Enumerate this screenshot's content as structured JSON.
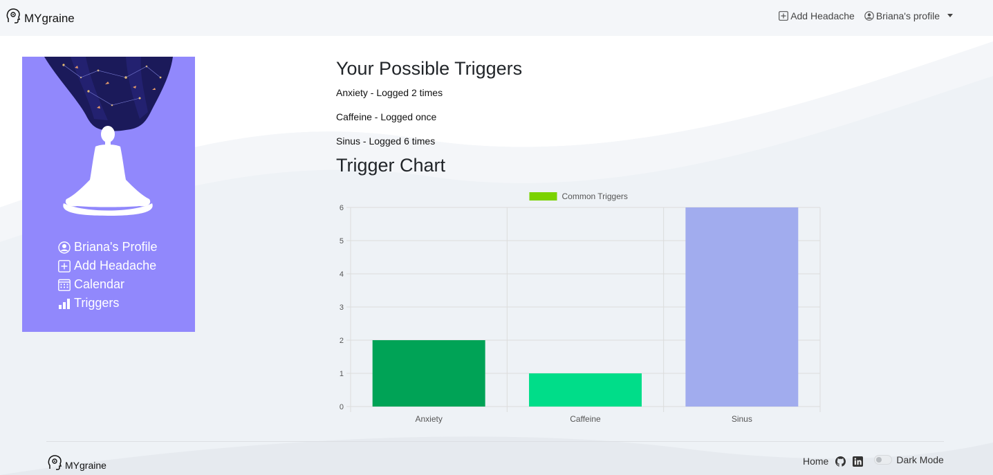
{
  "brand": {
    "name": "MYgraine",
    "icon": "head-gear-icon"
  },
  "navbar": {
    "add_headache": "Add Headache",
    "profile": "Briana's profile"
  },
  "sidebar": {
    "items": [
      {
        "label": "Briana's Profile",
        "icon": "user-circle-icon"
      },
      {
        "label": "Add Headache",
        "icon": "plus-square-icon"
      },
      {
        "label": "Calendar",
        "icon": "calendar-icon"
      },
      {
        "label": "Triggers",
        "icon": "bar-chart-icon"
      }
    ],
    "background_color": "#9188fc"
  },
  "main": {
    "title": "Your Possible Triggers",
    "triggers": [
      "Anxiety - Logged 2 times",
      "Caffeine - Logged once",
      "Sinus - Logged 6 times"
    ],
    "chart_title": "Trigger Chart"
  },
  "chart_data": {
    "type": "bar",
    "categories": [
      "Anxiety",
      "Caffeine",
      "Sinus"
    ],
    "series": [
      {
        "name": "Common Triggers",
        "values": [
          2,
          1,
          6
        ],
        "colors": [
          "#00a356",
          "#00dd89",
          "#a1acee"
        ]
      }
    ],
    "legend_color": "#7bd200",
    "legend": "top",
    "ylim": [
      0,
      6
    ],
    "yticks": [
      "0",
      "1",
      "2",
      "3",
      "4",
      "5",
      "6"
    ],
    "grid": true
  },
  "footer": {
    "brand": "MYgraine",
    "home": "Home",
    "dark_mode": "Dark Mode",
    "icons": [
      "github-icon",
      "linkedin-icon"
    ]
  }
}
